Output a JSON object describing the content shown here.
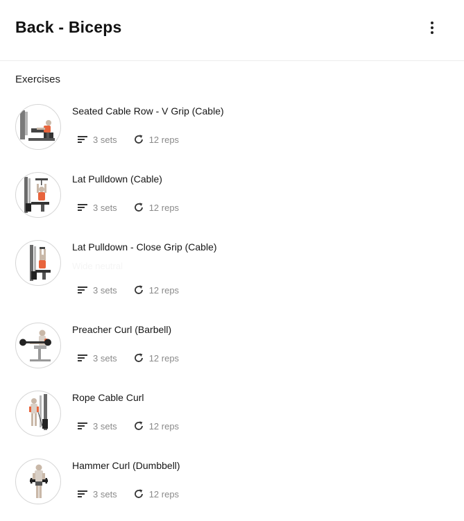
{
  "header": {
    "title": "Back - Biceps",
    "menu_icon": "more-vert-icon"
  },
  "section": {
    "label": "Exercises"
  },
  "exercises": [
    {
      "name": "Seated Cable Row - V Grip (Cable)",
      "note": "",
      "sets": "3 sets",
      "reps": "12 reps",
      "illustration": "seated-row-icon"
    },
    {
      "name": "Lat Pulldown (Cable)",
      "note": "",
      "sets": "3 sets",
      "reps": "12 reps",
      "illustration": "lat-pulldown-icon"
    },
    {
      "name": "Lat Pulldown - Close Grip (Cable)",
      "note": "Wide neutral",
      "sets": "3 sets",
      "reps": "12 reps",
      "illustration": "lat-pulldown-close-icon"
    },
    {
      "name": "Preacher Curl (Barbell)",
      "note": "",
      "sets": "3 sets",
      "reps": "12 reps",
      "illustration": "preacher-curl-icon"
    },
    {
      "name": "Rope Cable Curl",
      "note": "",
      "sets": "3 sets",
      "reps": "12 reps",
      "illustration": "rope-cable-curl-icon"
    },
    {
      "name": "Hammer Curl (Dumbbell)",
      "note": "",
      "sets": "3 sets",
      "reps": "12 reps",
      "illustration": "hammer-curl-icon"
    }
  ],
  "colors": {
    "accent_muscle": "#e8643c",
    "machine": "#6b6b6b",
    "meta_text": "#8a8a8a",
    "divider": "#ececec"
  }
}
